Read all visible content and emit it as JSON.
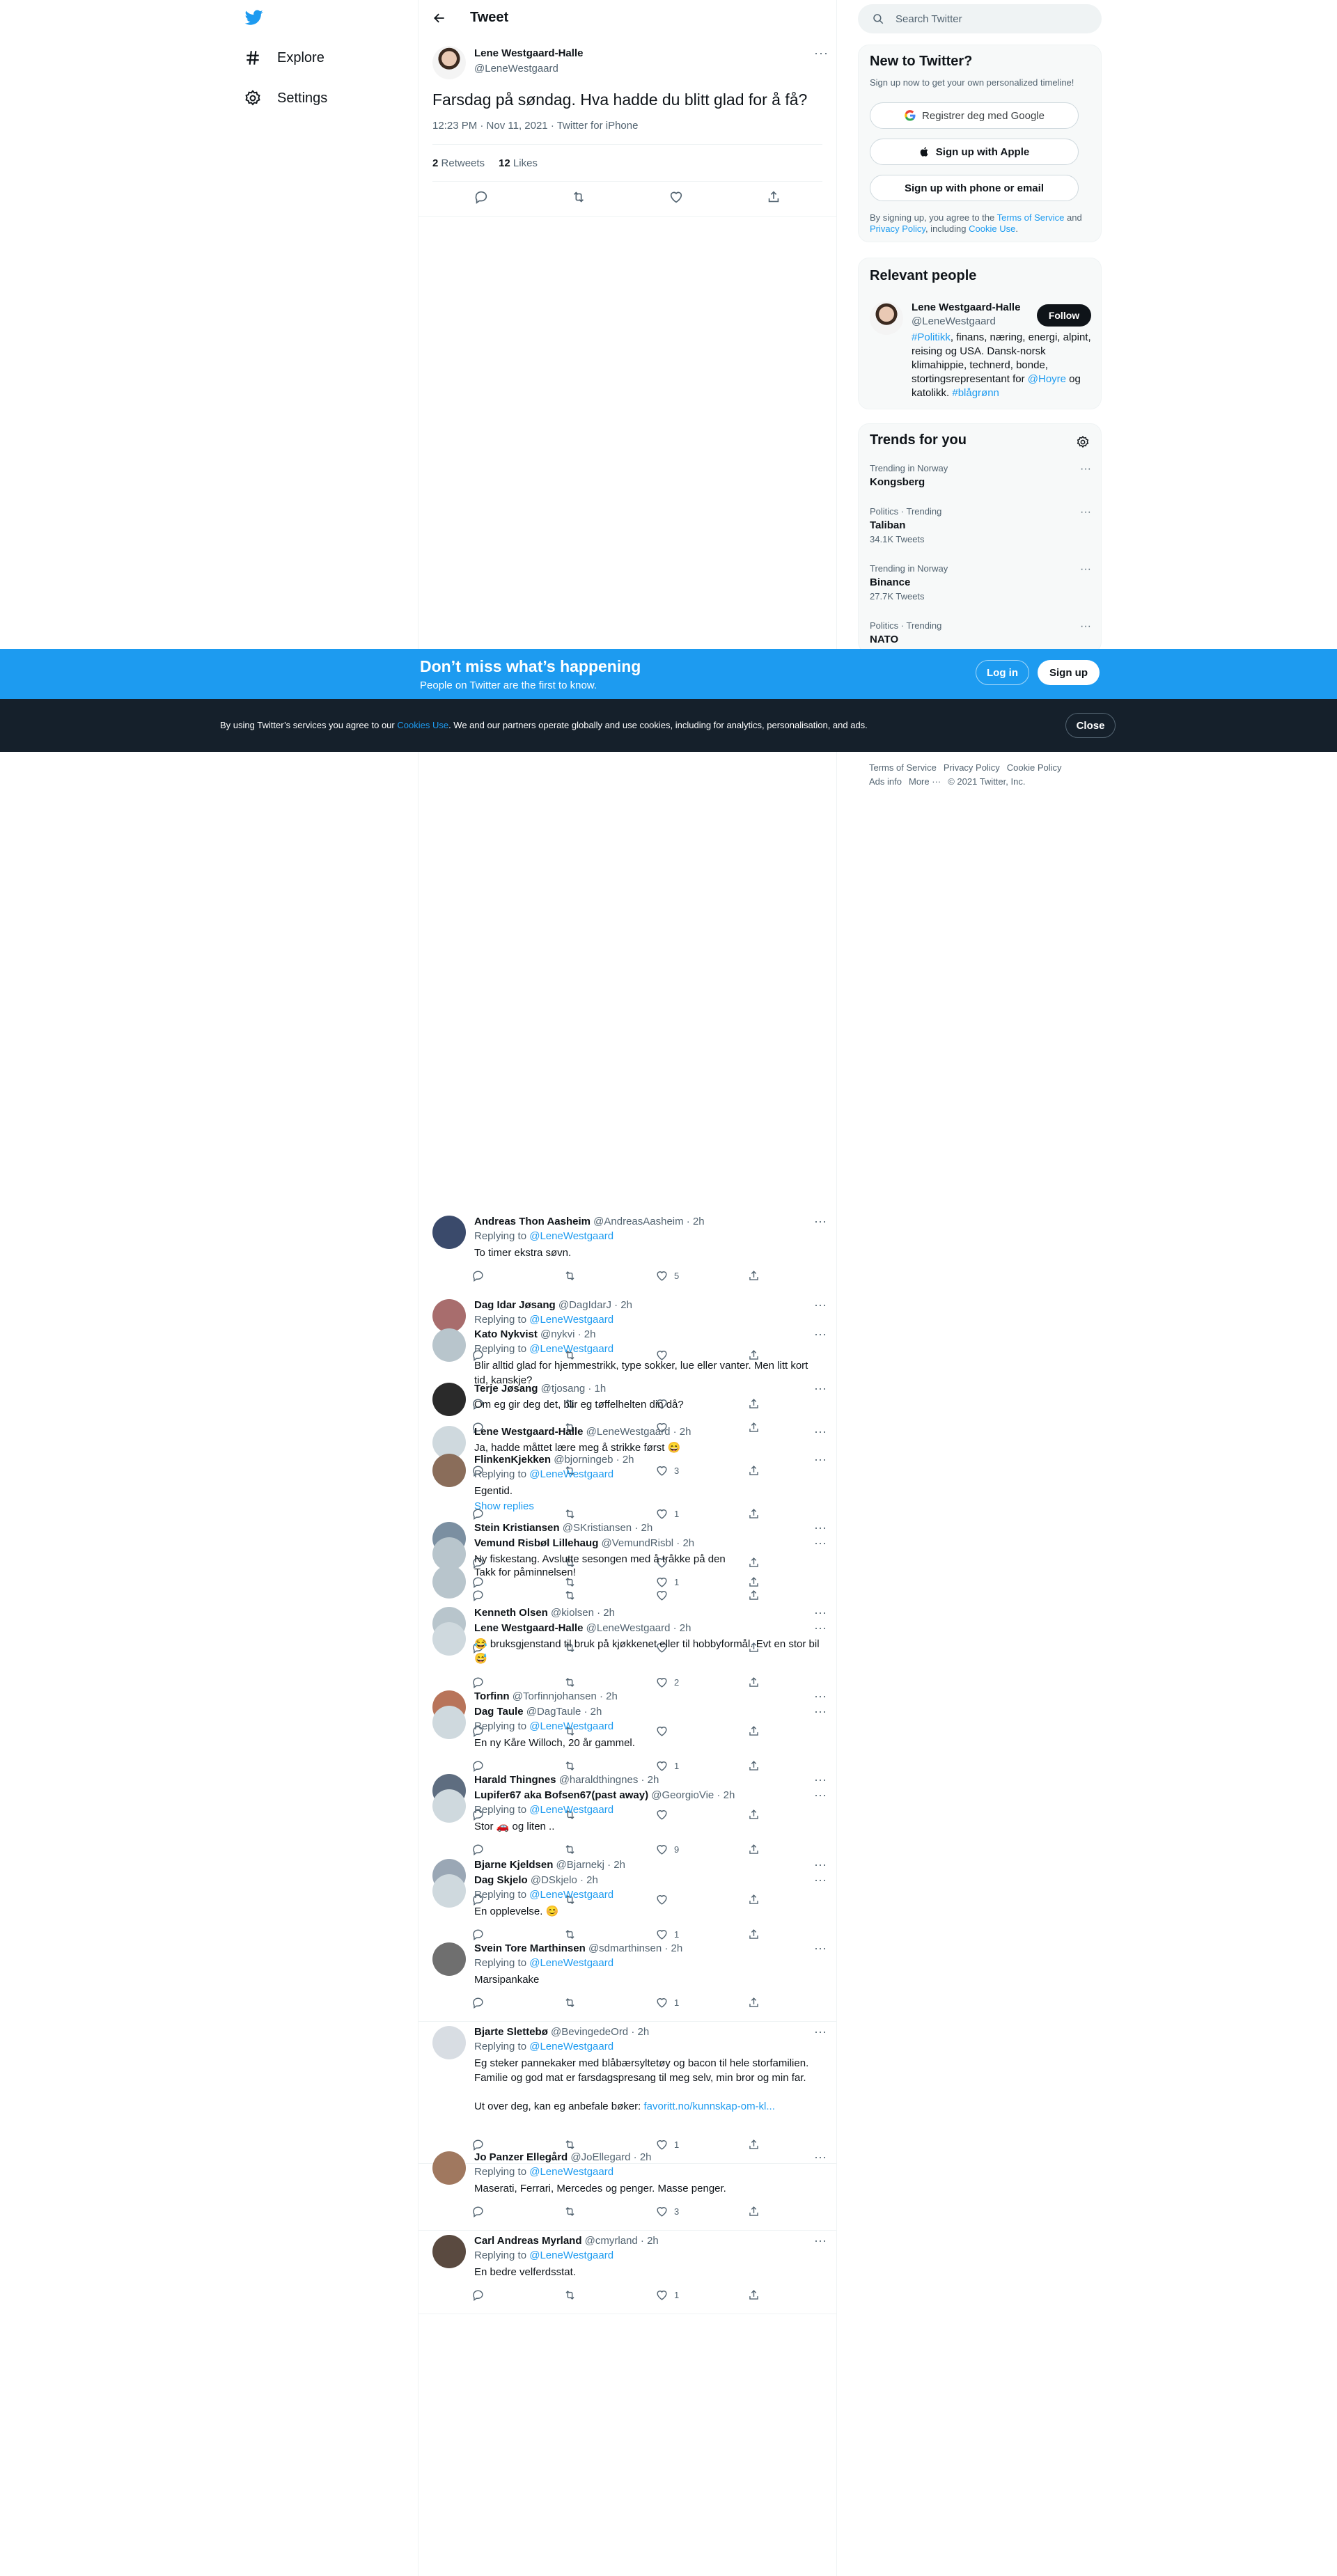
{
  "nav": {
    "logo": "twitter-logo",
    "items": [
      {
        "label": "Explore",
        "icon": "hashtag-icon"
      },
      {
        "label": "Settings",
        "icon": "gear-icon"
      }
    ]
  },
  "header": {
    "title": "Tweet"
  },
  "tweet": {
    "name": "Lene Westgaard-Halle",
    "handle": "@LeneWestgaard",
    "text": "Farsdag på søndag. Hva hadde du blitt glad for å få?",
    "time": "12:23 PM · Nov 11, 2021 · ",
    "source": "Twitter for iPhone",
    "retweets": "2",
    "retweets_label": "Retweets",
    "likes": "12",
    "likes_label": "Likes"
  },
  "replies": [
    {
      "name": "Andreas Thon Aasheim",
      "meta": "@AndreasAasheim · 2h",
      "reply_to": "@LeneWestgaard",
      "text": "To timer ekstra søvn.",
      "likes": "5"
    },
    {
      "name": "Dag Idar Jøsang",
      "meta": "@DagIdarJ · 2h",
      "reply_to": "@LeneWestgaard",
      "text": "",
      "likes": ""
    },
    {
      "name": "Kato Nykvist",
      "meta": "@nykvi · 2h",
      "reply_to": "@LeneWestgaard",
      "text": "Blir alltid glad for hjemmestrikk, type sokker, lue eller vanter. Men litt kort tid, kanskje?",
      "likes": ""
    },
    {
      "name": "Terje Jøsang",
      "meta": "@tjosang · 1h",
      "reply_to": "",
      "text": "Om eg gir deg det, blir eg tøffelhelten din då?",
      "likes": ""
    },
    {
      "name": "Lene Westgaard-Halle",
      "meta": "@LeneWestgaard · 2h",
      "reply_to": "",
      "text": "Ja, hadde måttet lære meg å strikke først 😄",
      "likes": "3"
    },
    {
      "name": "FlinkenKjekken",
      "meta": "@bjorningeb · 2h",
      "reply_to": "@LeneWestgaard",
      "text": "Egentid.",
      "likes": "1",
      "show_replies": "Show replies"
    },
    {
      "name": "Stein Kristiansen",
      "meta": "@SKristiansen · 2h",
      "reply_to": "",
      "text": "",
      "likes": ""
    },
    {
      "name": "Vemund Risbøl Lillehaug",
      "meta": "@VemundRisbl · 2h",
      "reply_to": "",
      "text": "Ny fiskestang. Avslutte sesongen med å tråkke på den",
      "likes": "1"
    },
    {
      "name": "",
      "meta": "",
      "reply_to": "",
      "text": "Takk for påminnelsen!",
      "likes": ""
    },
    {
      "name": "Kenneth Olsen",
      "meta": "@kiolsen · 2h",
      "reply_to": "",
      "text": "",
      "likes": ""
    },
    {
      "name": "Lene Westgaard-Halle",
      "meta": "@LeneWestgaard · 2h",
      "reply_to": "",
      "text": "😂 bruksgjenstand til bruk på kjøkkenet eller til hobbyformål. Evt en stor bil 😅",
      "likes": "2"
    },
    {
      "name": "Torfinn",
      "meta": "@Torfinnjohansen · 2h",
      "reply_to": "",
      "text": "",
      "likes": ""
    },
    {
      "name": "Dag Taule",
      "meta": "@DagTaule · 2h",
      "reply_to": "@LeneWestgaard",
      "text": "En ny Kåre Willoch, 20 år gammel.",
      "likes": "1"
    },
    {
      "name": "Harald Thingnes",
      "meta": "@haraldthingnes · 2h",
      "reply_to": "",
      "text": "",
      "likes": ""
    },
    {
      "name": "Lupifer67 aka Bofsen67(past away)",
      "meta": "@GeorgioVie · 2h",
      "reply_to": "@LeneWestgaard",
      "text": "Stor 🚗 og liten ..",
      "likes": "9"
    },
    {
      "name": "Bjarne Kjeldsen",
      "meta": "@Bjarnekj · 2h",
      "reply_to": "",
      "text": "",
      "likes": ""
    },
    {
      "name": "Dag Skjelo",
      "meta": "@DSkjelo · 2h",
      "reply_to": "@LeneWestgaard",
      "text": "En opplevelse. 😊",
      "likes": "1"
    },
    {
      "name": "Svein Tore Marthinsen",
      "meta": "@sdmarthinsen · 2h",
      "reply_to": "@LeneWestgaard",
      "text": "Marsipankake",
      "likes": "1"
    },
    {
      "name": "Bjarte Slettebø",
      "meta": "@BevingedeOrd · 2h",
      "reply_to": "@LeneWestgaard",
      "text": "Eg steker pannekaker med blåbærsyltetøy og bacon til hele storfamilien. Familie og god mat er farsdagspresang til meg selv, min bror og min far.",
      "text2": "Ut over deg, kan eg anbefale bøker: ",
      "link": "favoritt.no/kunnskap-om-kl...",
      "likes": "1"
    },
    {
      "name": "Jo Panzer Ellegård",
      "meta": "@JoEllegard · 2h",
      "reply_to": "@LeneWestgaard",
      "text": "Maserati, Ferrari, Mercedes og penger. Masse penger.",
      "likes": "3"
    },
    {
      "name": "Carl Andreas Myrland",
      "meta": "@cmyrland · 2h",
      "reply_to": "@LeneWestgaard",
      "text": "En bedre velferdsstat.",
      "likes": "1"
    }
  ],
  "replying_to_label": "Replying to ",
  "right": {
    "search_placeholder": "Search Twitter",
    "new_title": "New to Twitter?",
    "new_sub": "Sign up now to get your own personalized timeline!",
    "google_btn": "Registrer deg med Google",
    "apple_btn": "Sign up with Apple",
    "phone_btn": "Sign up with phone or email",
    "terms_a": "By signing up, you agree to the ",
    "terms_link": "Terms of Service",
    "terms_b": " and ",
    "privacy_link": "Privacy Policy",
    "terms_c": ", including ",
    "cookie_link": "Cookie Use",
    "terms_d": ".",
    "relevant_title": "Relevant people",
    "person_name": "Lene Westgaard-Halle",
    "person_handle": "@LeneWestgaard",
    "follow": "Follow",
    "bio_tag1": "#Politikk",
    "bio_1": ", finans, næring, energi, alpint, reising og USA. Dansk-norsk klimahippie, technerd, bonde, stortingsrepresentant for ",
    "bio_tag2": "@Hoyre",
    "bio_2": " og katolikk. ",
    "bio_tag3": "#blågrønn",
    "trends_title": "Trends for you",
    "trends": [
      {
        "ctx": "Trending in Norway",
        "name": "Kongsberg",
        "count": ""
      },
      {
        "ctx": "Politics · Trending",
        "name": "Taliban",
        "count": "34.1K Tweets"
      },
      {
        "ctx": "Trending in Norway",
        "name": "Binance",
        "count": "27.7K Tweets"
      },
      {
        "ctx": "Politics · Trending",
        "name": "NATO",
        "count": ""
      }
    ]
  },
  "banner": {
    "title": "Don’t miss what’s happening",
    "sub": "People on Twitter are the first to know.",
    "login": "Log in",
    "signup": "Sign up"
  },
  "cookie": {
    "text_a": "By using Twitter’s services you agree to our ",
    "link": "Cookies Use",
    "text_b": ". We and our partners operate globally and use cookies, including for analytics, personalisation, and ads.",
    "close": "Close"
  },
  "footer": {
    "items": [
      "Terms of Service",
      "Privacy Policy",
      "Cookie Policy"
    ],
    "items2": [
      "Ads info",
      "More ···",
      "© 2021 Twitter, Inc."
    ]
  },
  "colors": {
    "accent": "#1d9bf0",
    "text": "#0f1419",
    "muted": "#536471",
    "cookie_bg": "#15202b"
  }
}
